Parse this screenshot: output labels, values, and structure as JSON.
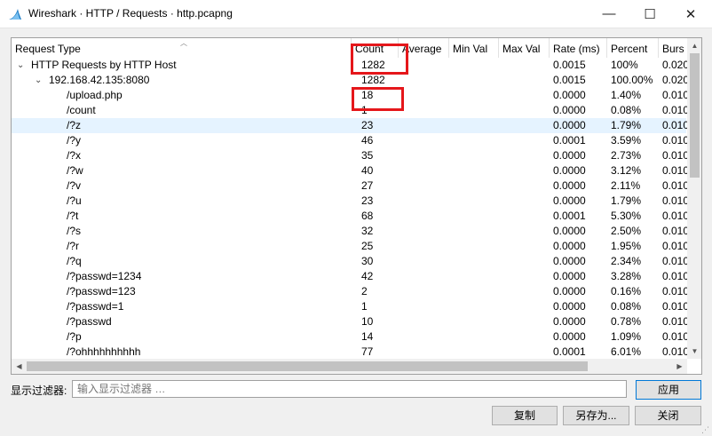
{
  "window": {
    "title": "Wireshark · HTTP / Requests · http.pcapng",
    "app_icon": "wireshark-fin-icon",
    "minimize_glyph": "—",
    "maximize_glyph": "☐",
    "close_glyph": "✕"
  },
  "table": {
    "columns": [
      "Request Type",
      "Count",
      "Average",
      "Min Val",
      "Max Val",
      "Rate (ms)",
      "Percent",
      "Burs"
    ],
    "rows": [
      {
        "expand": "⌄",
        "name": "HTTP Requests by HTTP Host",
        "count": "1282",
        "rate": "0.0015",
        "percent": "100%",
        "burst": "0.020"
      },
      {
        "expand": "⌄",
        "name": "192.168.42.135:8080",
        "count": "1282",
        "rate": "0.0015",
        "percent": "100.00%",
        "burst": "0.020"
      },
      {
        "name": "/upload.php",
        "count": "18",
        "rate": "0.0000",
        "percent": "1.40%",
        "burst": "0.010"
      },
      {
        "name": "/count",
        "count": "1",
        "rate": "0.0000",
        "percent": "0.08%",
        "burst": "0.010"
      },
      {
        "name": "/?z",
        "count": "23",
        "rate": "0.0000",
        "percent": "1.79%",
        "burst": "0.010"
      },
      {
        "name": "/?y",
        "count": "46",
        "rate": "0.0001",
        "percent": "3.59%",
        "burst": "0.010"
      },
      {
        "name": "/?x",
        "count": "35",
        "rate": "0.0000",
        "percent": "2.73%",
        "burst": "0.010"
      },
      {
        "name": "/?w",
        "count": "40",
        "rate": "0.0000",
        "percent": "3.12%",
        "burst": "0.010"
      },
      {
        "name": "/?v",
        "count": "27",
        "rate": "0.0000",
        "percent": "2.11%",
        "burst": "0.010"
      },
      {
        "name": "/?u",
        "count": "23",
        "rate": "0.0000",
        "percent": "1.79%",
        "burst": "0.010"
      },
      {
        "name": "/?t",
        "count": "68",
        "rate": "0.0001",
        "percent": "5.30%",
        "burst": "0.010"
      },
      {
        "name": "/?s",
        "count": "32",
        "rate": "0.0000",
        "percent": "2.50%",
        "burst": "0.010"
      },
      {
        "name": "/?r",
        "count": "25",
        "rate": "0.0000",
        "percent": "1.95%",
        "burst": "0.010"
      },
      {
        "name": "/?q",
        "count": "30",
        "rate": "0.0000",
        "percent": "2.34%",
        "burst": "0.010"
      },
      {
        "name": "/?passwd=1234",
        "count": "42",
        "rate": "0.0000",
        "percent": "3.28%",
        "burst": "0.010"
      },
      {
        "name": "/?passwd=123",
        "count": "2",
        "rate": "0.0000",
        "percent": "0.16%",
        "burst": "0.010"
      },
      {
        "name": "/?passwd=1",
        "count": "1",
        "rate": "0.0000",
        "percent": "0.08%",
        "burst": "0.010"
      },
      {
        "name": "/?passwd",
        "count": "10",
        "rate": "0.0000",
        "percent": "0.78%",
        "burst": "0.010"
      },
      {
        "name": "/?p",
        "count": "14",
        "rate": "0.0000",
        "percent": "1.09%",
        "burst": "0.010"
      },
      {
        "name": "/?ohhhhhhhhhh",
        "count": "77",
        "rate": "0.0001",
        "percent": "6.01%",
        "burst": "0.010"
      }
    ],
    "selected_row": 4
  },
  "filter": {
    "label": "显示过滤器:",
    "placeholder": "输入显示过滤器 …",
    "apply_label": "应用"
  },
  "buttons": {
    "copy": "复制",
    "save_as": "另存为...",
    "close": "关闭"
  },
  "colors": {
    "highlight_box": "#e5171b",
    "selected_row": "#e5f3ff",
    "apply_border": "#0078d7"
  }
}
